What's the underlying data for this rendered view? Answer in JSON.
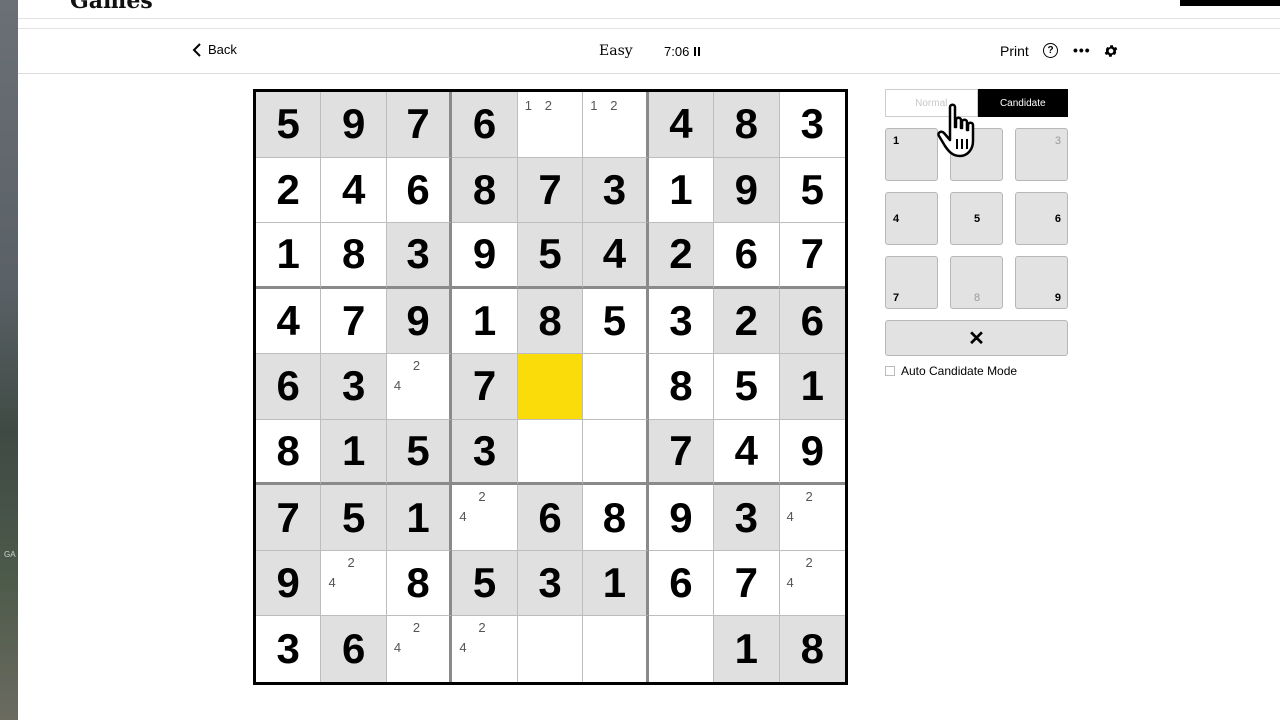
{
  "header": {
    "logo_text": "Games",
    "back_label": "Back",
    "difficulty": "Easy",
    "timer": "7:06",
    "print_label": "Print",
    "help_glyph": "?",
    "more_glyph": "•••"
  },
  "board": {
    "rows": [
      [
        "5",
        "9",
        "7",
        "6",
        "",
        "",
        "4",
        "8",
        "3"
      ],
      [
        "2",
        "4",
        "6",
        "8",
        "7",
        "3",
        "1",
        "9",
        "5"
      ],
      [
        "1",
        "8",
        "3",
        "9",
        "5",
        "4",
        "2",
        "6",
        "7"
      ],
      [
        "4",
        "7",
        "9",
        "1",
        "8",
        "5",
        "3",
        "2",
        "6"
      ],
      [
        "6",
        "3",
        "",
        "7",
        "",
        "",
        "8",
        "5",
        "1"
      ],
      [
        "8",
        "1",
        "5",
        "3",
        "",
        "",
        "7",
        "4",
        "9"
      ],
      [
        "7",
        "5",
        "1",
        "",
        "6",
        "8",
        "9",
        "3",
        ""
      ],
      [
        "9",
        "",
        "8",
        "5",
        "3",
        "1",
        "6",
        "7",
        ""
      ],
      [
        "3",
        "6",
        "",
        "",
        "",
        "",
        "",
        "1",
        "8"
      ]
    ],
    "given": [
      [
        1,
        1,
        1,
        1,
        0,
        0,
        1,
        1,
        0
      ],
      [
        0,
        0,
        0,
        1,
        1,
        1,
        0,
        1,
        0
      ],
      [
        0,
        0,
        1,
        0,
        1,
        1,
        1,
        0,
        0
      ],
      [
        0,
        0,
        1,
        0,
        1,
        0,
        0,
        1,
        1
      ],
      [
        1,
        1,
        0,
        1,
        0,
        0,
        0,
        0,
        1
      ],
      [
        0,
        1,
        1,
        1,
        0,
        0,
        1,
        0,
        0
      ],
      [
        1,
        1,
        1,
        0,
        1,
        0,
        0,
        1,
        0
      ],
      [
        1,
        0,
        0,
        1,
        1,
        1,
        0,
        0,
        0
      ],
      [
        0,
        1,
        0,
        0,
        0,
        0,
        0,
        1,
        1
      ]
    ],
    "selected": [
      4,
      4
    ],
    "candidates": [
      {
        "r": 0,
        "c": 4,
        "n": [
          "1",
          "2"
        ]
      },
      {
        "r": 0,
        "c": 5,
        "n": [
          "1",
          "2"
        ]
      },
      {
        "r": 4,
        "c": 2,
        "n": [
          "2",
          "4"
        ]
      },
      {
        "r": 6,
        "c": 3,
        "n": [
          "2",
          "4"
        ]
      },
      {
        "r": 6,
        "c": 8,
        "n": [
          "2",
          "4"
        ]
      },
      {
        "r": 7,
        "c": 1,
        "n": [
          "2",
          "4"
        ]
      },
      {
        "r": 7,
        "c": 8,
        "n": [
          "2",
          "4"
        ]
      },
      {
        "r": 8,
        "c": 2,
        "n": [
          "2",
          "4"
        ]
      },
      {
        "r": 8,
        "c": 3,
        "n": [
          "2",
          "4"
        ]
      }
    ]
  },
  "mode": {
    "normal_label": "Normal",
    "candidate_label": "Candidate",
    "active": "Candidate"
  },
  "numpad": {
    "keys": [
      {
        "label": "1",
        "muted": false
      },
      {
        "label": "",
        "muted": false
      },
      {
        "label": "3",
        "muted": true
      },
      {
        "label": "4",
        "muted": false
      },
      {
        "label": "5",
        "muted": false
      },
      {
        "label": "6",
        "muted": false
      },
      {
        "label": "7",
        "muted": false
      },
      {
        "label": "8",
        "muted": true
      },
      {
        "label": "9",
        "muted": false
      }
    ],
    "erase_glyph": "✕"
  },
  "auto_candidate_label": "Auto Candidate Mode",
  "colors": {
    "given_bg": "#e0e0e0",
    "selected_bg": "#f9dc0a",
    "active_tab_bg": "#000000"
  }
}
